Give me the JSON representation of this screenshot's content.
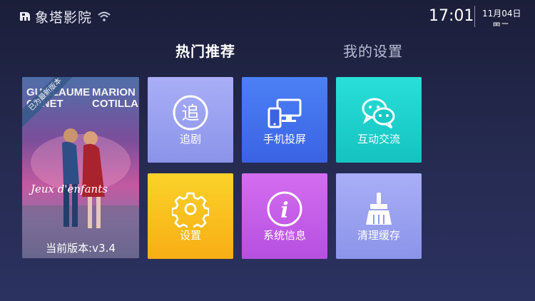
{
  "header": {
    "brand": "象塔影院",
    "time": "17:01",
    "date": "11月04日",
    "weekday": "周二"
  },
  "tabs": [
    {
      "label": "热门推荐",
      "active": true
    },
    {
      "label": "我的设置",
      "active": false
    }
  ],
  "poster": {
    "ribbon": "已为最新版本",
    "names": [
      "GUILLAUME",
      "MARION",
      "CANET",
      "COTILLARD"
    ],
    "title": "Jeux d'enfants",
    "version": "当前版本:v3.4"
  },
  "tiles": [
    {
      "label": "追剧",
      "icon": "chase-drama-icon",
      "glyph": "追"
    },
    {
      "label": "手机投屏",
      "icon": "screen-cast-icon"
    },
    {
      "label": "互动交流",
      "icon": "chat-bubbles-icon"
    },
    {
      "label": "设置",
      "icon": "gear-icon"
    },
    {
      "label": "系统信息",
      "icon": "info-icon",
      "glyph": "i"
    },
    {
      "label": "清理缓存",
      "icon": "broom-icon"
    }
  ],
  "colors": {
    "tile_lavender": "#9aa1f0",
    "tile_blue": "#4270ec",
    "tile_teal": "#1fd1cc",
    "tile_yellow": "#f9c11f",
    "tile_purple": "#c55ee8",
    "background": "#22264a"
  }
}
